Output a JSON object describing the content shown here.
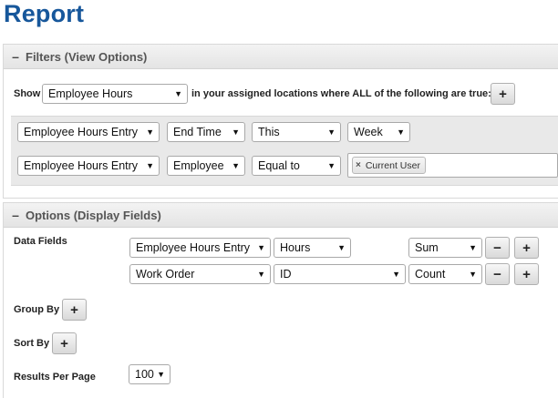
{
  "title": "Report",
  "filters": {
    "header": "Filters (View Options)",
    "show_label": "Show",
    "show_value": "Employee Hours",
    "locations_text": "in your assigned locations where ALL of the following are true:",
    "add_label": "+",
    "rows": [
      {
        "entity": "Employee Hours Entry",
        "field": "End Time",
        "operator": "This",
        "value": "Week"
      },
      {
        "entity": "Employee Hours Entry",
        "field": "Employee",
        "operator": "Equal to",
        "tag": "Current User"
      }
    ]
  },
  "options": {
    "header": "Options (Display Fields)",
    "data_fields_label": "Data Fields",
    "data_fields": [
      {
        "entity": "Employee Hours Entry",
        "field": "Hours",
        "aggregate": "Sum",
        "minus": "−",
        "plus": "+"
      },
      {
        "entity": "Work Order",
        "field": "ID",
        "aggregate": "Count",
        "minus": "−",
        "plus": "+"
      }
    ],
    "group_by_label": "Group By",
    "sort_by_label": "Sort By",
    "add_label": "+",
    "results_per_page_label": "Results Per Page",
    "results_per_page": "100"
  },
  "collapse_symbol": "–",
  "dropdown_arrow": "▼",
  "remove_symbol": "×"
}
